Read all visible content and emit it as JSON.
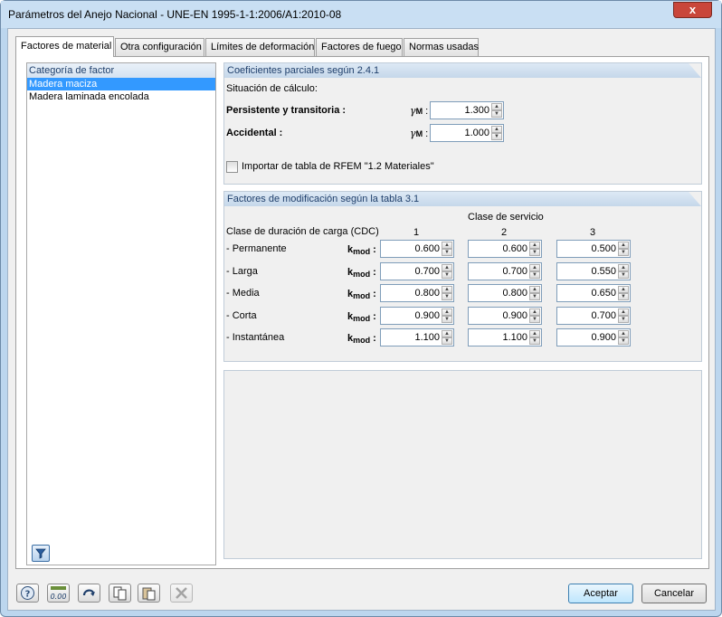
{
  "window": {
    "title": "Parámetros del Anejo Nacional - UNE-EN 1995-1-1:2006/A1:2010-08",
    "close": "x"
  },
  "tabs": [
    "Factores de material",
    "Otra configuración",
    "Límites de deformación",
    "Factores de fuego",
    "Normas usadas"
  ],
  "category": {
    "header": "Categoría de factor",
    "items": [
      "Madera maciza",
      "Madera laminada encolada"
    ]
  },
  "partial": {
    "header": "Coeficientes parciales según 2.4.1",
    "situation": "Situación de cálculo:",
    "rows": [
      {
        "label": "Persistente y transitoria :",
        "symbol": "γ",
        "sub": "M",
        "value": "1.300"
      },
      {
        "label": "Accidental :",
        "symbol": "γ",
        "sub": "M",
        "value": "1.000"
      }
    ],
    "import_label": "Importar de tabla de RFEM \"1.2 Materiales\""
  },
  "kmod": {
    "header": "Factores de modificación según la tabla 3.1",
    "service_class": "Clase de servicio",
    "duration_label": "Clase de duración de carga (CDC)",
    "cols": [
      "1",
      "2",
      "3"
    ],
    "symbol": "k",
    "sub": "mod",
    "rows": [
      {
        "label": "- Permanente",
        "values": [
          "0.600",
          "0.600",
          "0.500"
        ]
      },
      {
        "label": "- Larga",
        "values": [
          "0.700",
          "0.700",
          "0.550"
        ]
      },
      {
        "label": "- Media",
        "values": [
          "0.800",
          "0.800",
          "0.650"
        ]
      },
      {
        "label": "- Corta",
        "values": [
          "0.900",
          "0.900",
          "0.700"
        ]
      },
      {
        "label": "- Instantánea",
        "values": [
          "1.100",
          "1.100",
          "0.900"
        ]
      }
    ]
  },
  "buttons": {
    "ok": "Aceptar",
    "cancel": "Cancelar"
  }
}
